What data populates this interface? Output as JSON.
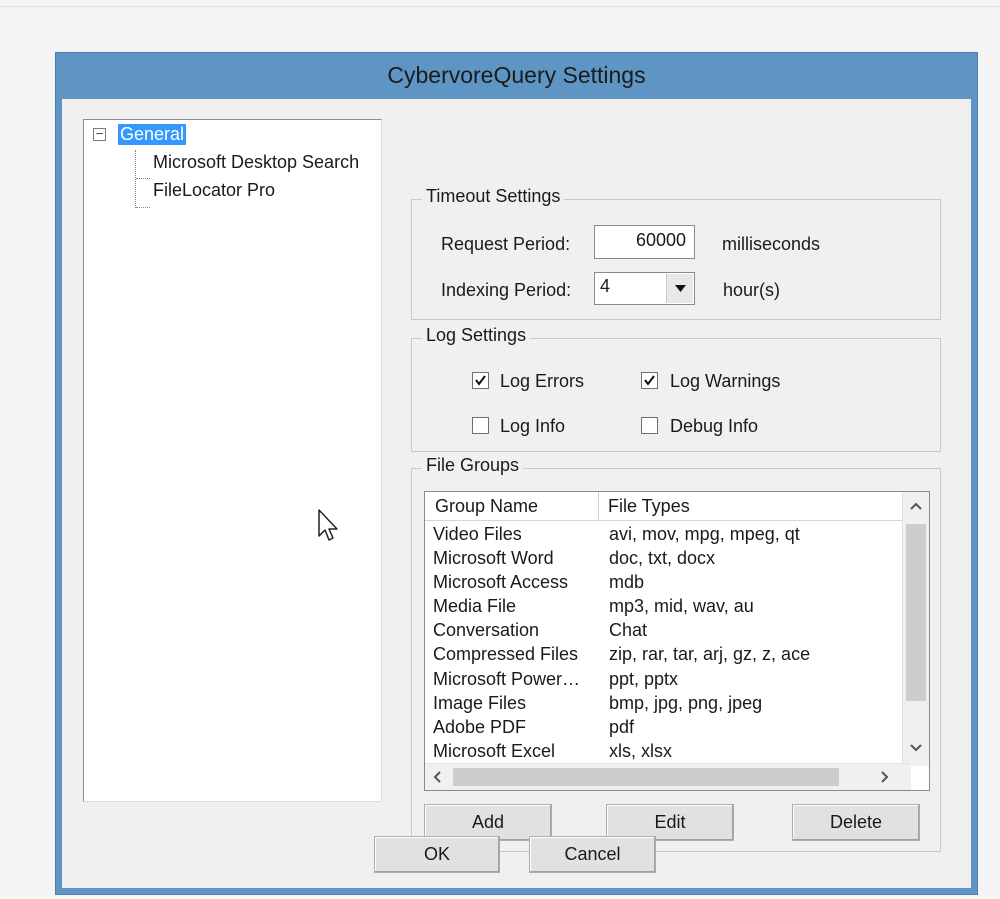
{
  "window": {
    "title": "CybervoreQuery Settings"
  },
  "tree": {
    "collapse_glyph": "−",
    "root": "General",
    "children": [
      "Microsoft Desktop Search",
      "FileLocator Pro"
    ]
  },
  "timeout": {
    "title": "Timeout Settings",
    "request_label": "Request Period:",
    "request_value": "60000",
    "request_unit": "milliseconds",
    "indexing_label": "Indexing Period:",
    "indexing_value": "4",
    "indexing_unit": "hour(s)"
  },
  "log": {
    "title": "Log Settings",
    "options": [
      {
        "label": "Log Errors",
        "checked": true
      },
      {
        "label": "Log Warnings",
        "checked": true
      },
      {
        "label": "Log Info",
        "checked": false
      },
      {
        "label": "Debug Info",
        "checked": false
      }
    ]
  },
  "file_groups": {
    "title": "File Groups",
    "columns": [
      "Group Name",
      "File Types"
    ],
    "rows": [
      [
        "Video Files",
        "avi, mov, mpg, mpeg, qt"
      ],
      [
        "Microsoft Word",
        "doc, txt, docx"
      ],
      [
        "Microsoft Access",
        "mdb"
      ],
      [
        "Media File",
        "mp3, mid, wav, au"
      ],
      [
        "Conversation",
        "Chat"
      ],
      [
        "Compressed Files",
        "zip, rar, tar, arj, gz, z, ace"
      ],
      [
        "Microsoft Power…",
        "ppt, pptx"
      ],
      [
        "Image Files",
        "bmp, jpg, png, jpeg"
      ],
      [
        "Adobe PDF",
        "pdf"
      ],
      [
        "Microsoft Excel",
        "xls, xlsx"
      ]
    ],
    "add_label": "Add",
    "edit_label": "Edit",
    "delete_label": "Delete"
  },
  "dialog": {
    "ok_label": "OK",
    "cancel_label": "Cancel"
  },
  "colors": {
    "title_bar": "#5f95c5",
    "selection": "#3399ff"
  }
}
